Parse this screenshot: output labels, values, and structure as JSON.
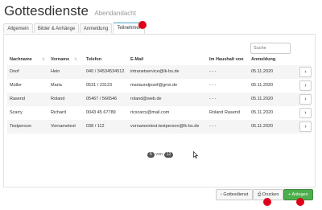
{
  "header": {
    "title": "Gottesdienste",
    "subtitle": "Abendandacht"
  },
  "tabs": [
    {
      "label": "Allgemein"
    },
    {
      "label": "Bilder & Anhänge"
    },
    {
      "label": "Anmeldung"
    },
    {
      "label": "Teilnehmer"
    }
  ],
  "search": {
    "placeholder": "Suche"
  },
  "table": {
    "columns": [
      "Nachname",
      "Vorname",
      "Telefon",
      "E-Mail",
      "Im Haushalt von",
      "Anmeldung"
    ],
    "rows": [
      {
        "nachname": "Doof",
        "vorname": "Hein",
        "telefon": "040 / 34534534512",
        "email": "intranetservice@lk-bs.de",
        "haushalt": "- - -",
        "anmeldung": "05.11.2020"
      },
      {
        "nachname": "Müller",
        "vorname": "Maria",
        "telefon": "0531 / 23123",
        "email": "mariaundjosef@gmx.de",
        "haushalt": "- - -",
        "anmeldung": "05.11.2020"
      },
      {
        "nachname": "Rasend",
        "vorname": "Roland",
        "telefon": "05467 / 566546",
        "email": "roland@web.de",
        "haushalt": "- - -",
        "anmeldung": "05.11.2020"
      },
      {
        "nachname": "Scarry",
        "vorname": "Richard",
        "telefon": "0043 45 67789",
        "email": "ricscarry@mail.com",
        "haushalt": "Roland Rasend",
        "anmeldung": "05.11.2020"
      },
      {
        "nachname": "Testperson",
        "vorname": "Vornametest",
        "telefon": "038 / 112",
        "email": "vornamentest.testperson@lk-bs.de",
        "haushalt": "- - -",
        "anmeldung": "05.11.2020"
      }
    ]
  },
  "pager": {
    "current": "5",
    "separator": "von",
    "total": "12"
  },
  "buttons": {
    "back": "Gottesdienst",
    "print": "Drucken",
    "add": "Anlegen"
  },
  "icons": {
    "row_action": "chevron-right-icon",
    "back": "chevron-left-icon",
    "print": "printer-icon",
    "add": "plus-icon"
  },
  "colors": {
    "accent": "#4aa3c8",
    "add_button": "#4cae4c",
    "marker": "#e0001a"
  }
}
